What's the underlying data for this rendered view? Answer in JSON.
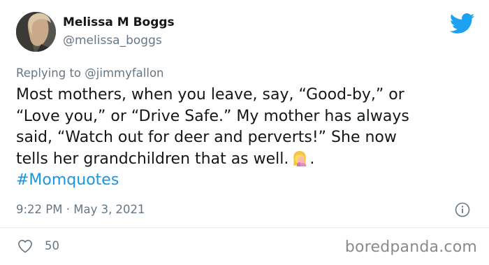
{
  "tweet": {
    "author": {
      "display_name": "Melissa M Boggs",
      "handle": "@melissa_boggs",
      "avatar": "profile-photo"
    },
    "reply": {
      "prefix": "Replying to",
      "mention": "@jimmyfallon"
    },
    "text_lines": [
      "Most mothers, when you leave, say, “Good-by,” or",
      "“Love you,” or “Drive Safe.” My mother has always",
      "said, “Watch out for deer and perverts!” She now",
      "tells her grandchildren that as well."
    ],
    "text_suffix": ".",
    "emoji": "woman-facepalming",
    "hashtag": "#Momquotes",
    "timestamp": "9:22 PM · May 3, 2021",
    "likes": "50",
    "platform_icon": "twitter-bird",
    "info_icon": "info-icon",
    "like_icon": "heart-outline"
  },
  "watermark": "boredpanda.com",
  "colors": {
    "text": "#14171a",
    "secondary": "#657786",
    "link": "#1b95e0",
    "brand": "#1da1f2",
    "divider": "#e6ecf0"
  }
}
